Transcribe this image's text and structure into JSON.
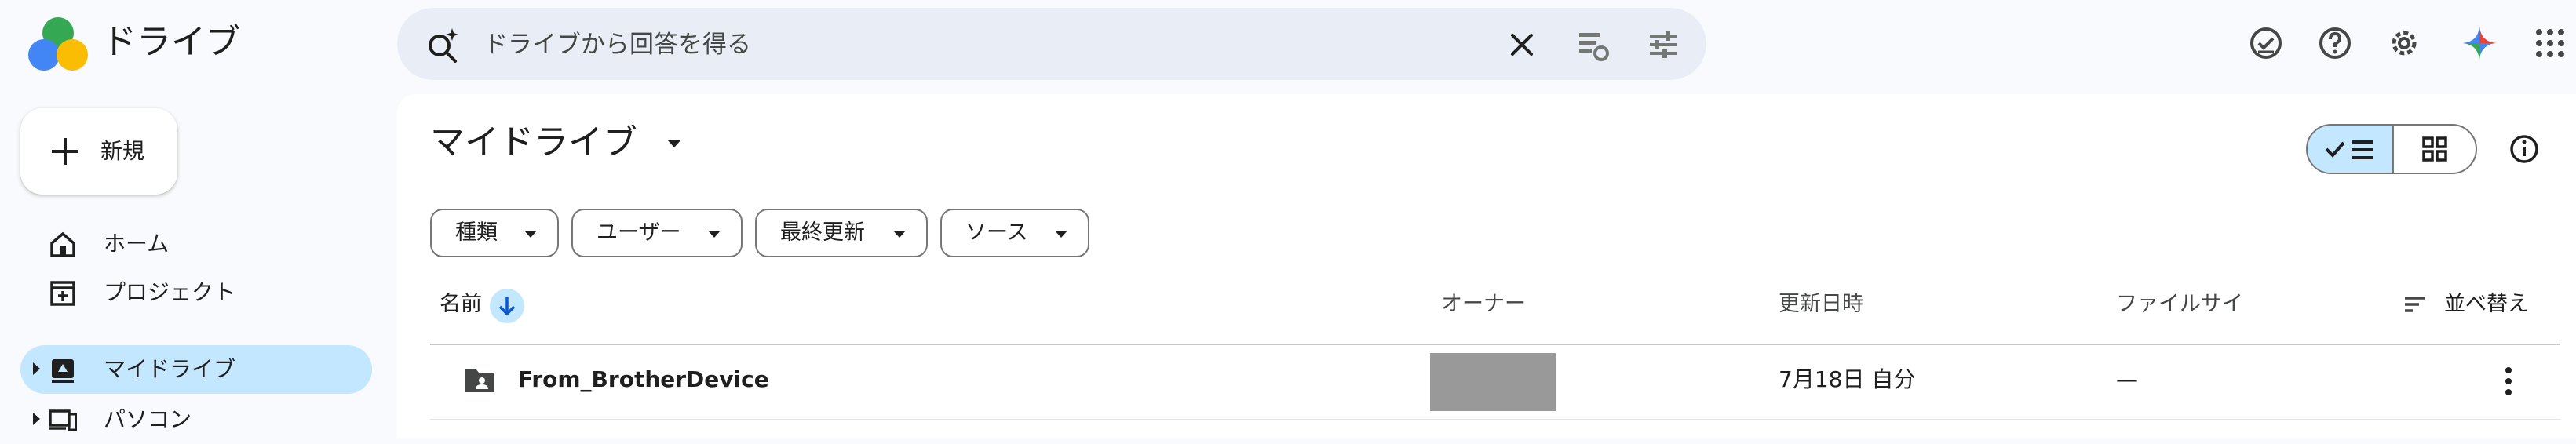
{
  "app": {
    "title": "ドライブ"
  },
  "search": {
    "placeholder": "ドライブから回答を得る",
    "icons": [
      "search-spark-icon",
      "clear-icon",
      "search-chips-icon",
      "search-options-icon"
    ]
  },
  "header_icons": [
    "offline-ready-icon",
    "help-icon",
    "settings-icon",
    "gemini-icon",
    "apps-grid-icon"
  ],
  "sidebar": {
    "new_label": "新規",
    "items": [
      {
        "label": "ホーム",
        "icon": "home-icon"
      },
      {
        "label": "プロジェクト",
        "icon": "project-icon"
      },
      {
        "label": "マイドライブ",
        "icon": "my-drive-icon",
        "active": true
      },
      {
        "label": "パソコン",
        "icon": "computers-icon"
      }
    ]
  },
  "main": {
    "title": "マイドライブ",
    "filters": [
      "種類",
      "ユーザー",
      "最終更新",
      "ソース"
    ],
    "columns": {
      "name": "名前",
      "owner": "オーナー",
      "modified": "更新日時",
      "size": "ファイルサイ",
      "sort": "並べ替え"
    },
    "rows": [
      {
        "name": "From_BrotherDevice",
        "modified": "7月18日 自分",
        "size": "—"
      }
    ]
  },
  "colors": {
    "accent": "#c2e7ff",
    "background": "#f8fafd",
    "search_bg": "#e9eef6"
  }
}
